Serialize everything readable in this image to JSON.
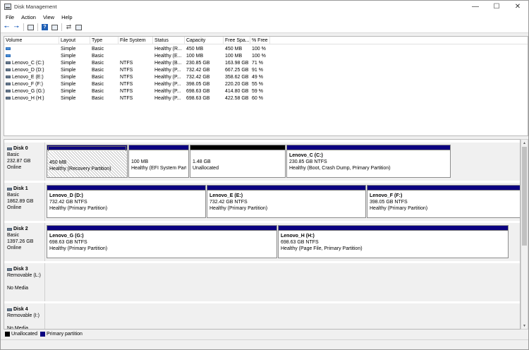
{
  "window": {
    "title": "Disk Management"
  },
  "menu": [
    "File",
    "Action",
    "View",
    "Help"
  ],
  "volume_table": {
    "headers": [
      "Volume",
      "Layout",
      "Type",
      "File System",
      "Status",
      "Capacity",
      "Free Spa...",
      "% Free"
    ],
    "rows": [
      {
        "volume": "",
        "layout": "Simple",
        "type": "Basic",
        "fs": "",
        "status": "Healthy (R...",
        "capacity": "450 MB",
        "free": "450 MB",
        "pct": "100 %"
      },
      {
        "volume": "",
        "layout": "Simple",
        "type": "Basic",
        "fs": "",
        "status": "Healthy (E...",
        "capacity": "100 MB",
        "free": "100 MB",
        "pct": "100 %"
      },
      {
        "volume": "Lenovo_C (C:)",
        "layout": "Simple",
        "type": "Basic",
        "fs": "NTFS",
        "status": "Healthy (B...",
        "capacity": "230.85 GB",
        "free": "163.98 GB",
        "pct": "71 %"
      },
      {
        "volume": "Lenovo_D (D:)",
        "layout": "Simple",
        "type": "Basic",
        "fs": "NTFS",
        "status": "Healthy (P...",
        "capacity": "732.42 GB",
        "free": "667.25 GB",
        "pct": "91 %"
      },
      {
        "volume": "Lenovo_E (E:)",
        "layout": "Simple",
        "type": "Basic",
        "fs": "NTFS",
        "status": "Healthy (P...",
        "capacity": "732.42 GB",
        "free": "358.62 GB",
        "pct": "49 %"
      },
      {
        "volume": "Lenovo_F (F:)",
        "layout": "Simple",
        "type": "Basic",
        "fs": "NTFS",
        "status": "Healthy (P...",
        "capacity": "398.05 GB",
        "free": "220.20 GB",
        "pct": "55 %"
      },
      {
        "volume": "Lenovo_G (G:)",
        "layout": "Simple",
        "type": "Basic",
        "fs": "NTFS",
        "status": "Healthy (P...",
        "capacity": "698.63 GB",
        "free": "414.80 GB",
        "pct": "59 %"
      },
      {
        "volume": "Lenovo_H (H:)",
        "layout": "Simple",
        "type": "Basic",
        "fs": "NTFS",
        "status": "Healthy (P...",
        "capacity": "698.63 GB",
        "free": "422.58 GB",
        "pct": "60 %"
      }
    ]
  },
  "disks": [
    {
      "name": "Disk 0",
      "type": "Basic",
      "size": "232.87 GB",
      "state": "Online",
      "partitions": [
        {
          "name": "",
          "size": "450 MB",
          "status": "Healthy (Recovery Partition)",
          "bar": "primary",
          "hatched": true
        },
        {
          "name": "",
          "size": "100 MB",
          "status": "Healthy (EFI System Partit",
          "bar": "primary",
          "hatched": false
        },
        {
          "name": "",
          "size": "1.48 GB",
          "status": "Unallocated",
          "bar": "unallocated",
          "hatched": false
        },
        {
          "name": "Lenovo_C  (C:)",
          "size": "230.85 GB NTFS",
          "status": "Healthy (Boot, Crash Dump, Primary Partition)",
          "bar": "primary",
          "hatched": false
        }
      ]
    },
    {
      "name": "Disk 1",
      "type": "Basic",
      "size": "1862.89 GB",
      "state": "Online",
      "partitions": [
        {
          "name": "Lenovo_D  (D:)",
          "size": "732.42 GB NTFS",
          "status": "Healthy (Primary Partition)",
          "bar": "primary",
          "hatched": false
        },
        {
          "name": "Lenovo_E  (E:)",
          "size": "732.42 GB NTFS",
          "status": "Healthy (Primary Partition)",
          "bar": "primary",
          "hatched": false
        },
        {
          "name": "Lenovo_F  (F:)",
          "size": "398.05 GB NTFS",
          "status": "Healthy (Primary Partition)",
          "bar": "primary",
          "hatched": false
        }
      ]
    },
    {
      "name": "Disk 2",
      "type": "Basic",
      "size": "1397.26 GB",
      "state": "Online",
      "partitions": [
        {
          "name": "Lenovo_G  (G:)",
          "size": "698.63 GB NTFS",
          "status": "Healthy (Primary Partition)",
          "bar": "primary",
          "hatched": false
        },
        {
          "name": "Lenovo_H  (H:)",
          "size": "698.63 GB NTFS",
          "status": "Healthy (Page File, Primary Partition)",
          "bar": "primary",
          "hatched": false
        }
      ]
    },
    {
      "name": "Disk 3",
      "type": "Removable (L:)",
      "size": "",
      "state": "No Media",
      "partitions": []
    },
    {
      "name": "Disk 4",
      "type": "Removable (I:)",
      "size": "",
      "state": "No Media",
      "partitions": []
    }
  ],
  "legend": [
    {
      "label": "Unallocated",
      "color": "#000000"
    },
    {
      "label": "Primary partition",
      "color": "#0b0080"
    }
  ],
  "colors": {
    "primary_bar": "#0b0080",
    "unallocated_bar": "#000000"
  }
}
